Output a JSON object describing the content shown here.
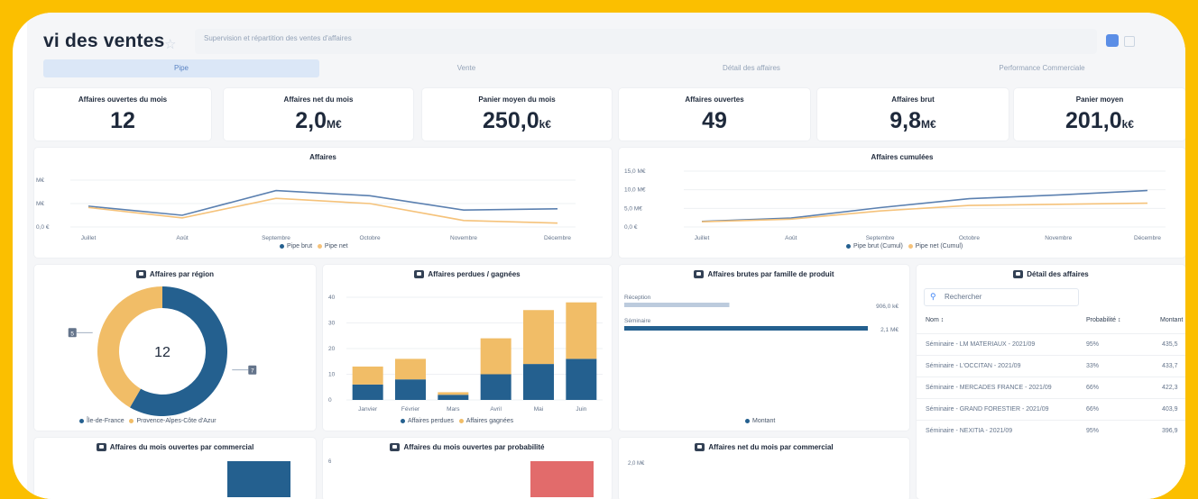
{
  "app": {
    "title": "vi des ventes",
    "subtitle": "Supervision et répartition des ventes d'affaires"
  },
  "tabs": [
    "Pipe",
    "Vente",
    "Détail des affaires",
    "Performance Commerciale"
  ],
  "kpis": [
    {
      "label": "Affaires ouvertes du mois",
      "value": "12",
      "unit": ""
    },
    {
      "label": "Affaires net du mois",
      "value": "2,0",
      "unit": "M€"
    },
    {
      "label": "Panier moyen du mois",
      "value": "250,0",
      "unit": "k€"
    },
    {
      "label": "Affaires ouvertes",
      "value": "49",
      "unit": ""
    },
    {
      "label": "Affaires brut",
      "value": "9,8",
      "unit": "M€"
    },
    {
      "label": "Panier moyen",
      "value": "201,0",
      "unit": "k€"
    }
  ],
  "colors": {
    "brut": "#5b80b0",
    "net": "#f5c27a",
    "dark_blue": "#24608f",
    "orange": "#f1bd67",
    "light": "#bccbdd",
    "red": "#e26b6b"
  },
  "chart_data": [
    {
      "type": "line",
      "title": "Affaires",
      "categories": [
        "Juillet",
        "Août",
        "Septembre",
        "Octobre",
        "Novembre",
        "Décembre"
      ],
      "y_ticks": [
        "M€",
        "M€",
        "0,0 €"
      ],
      "series": [
        {
          "name": "Pipe brut",
          "values": [
            1.6,
            0.9,
            2.8,
            2.4,
            1.3,
            1.4
          ]
        },
        {
          "name": "Pipe net",
          "values": [
            1.5,
            0.7,
            2.2,
            1.8,
            0.5,
            0.3
          ]
        }
      ],
      "ylim": [
        0,
        3.6
      ],
      "legend_position": "bottom"
    },
    {
      "type": "line",
      "title": "Affaires cumulées",
      "categories": [
        "Juillet",
        "Août",
        "Septembre",
        "Octobre",
        "Novembre",
        "Décembre"
      ],
      "y_ticks": [
        "15,0 M€",
        "10,0 M€",
        "5,0 M€",
        "0,0 €"
      ],
      "series": [
        {
          "name": "Pipe brut (Cumul)",
          "values": [
            1.5,
            2.4,
            5.2,
            7.6,
            8.6,
            9.8
          ]
        },
        {
          "name": "Pipe net (Cumul)",
          "values": [
            1.4,
            2.1,
            4.3,
            5.8,
            6.1,
            6.4
          ]
        }
      ],
      "ylim": [
        0,
        15
      ],
      "legend_position": "bottom"
    },
    {
      "type": "pie",
      "title": "Affaires par région",
      "center_label": "12",
      "slices": [
        {
          "name": "Île-de-France",
          "value": 7
        },
        {
          "name": "Provence-Alpes-Côte d'Azur",
          "value": 5
        }
      ],
      "legend_position": "bottom"
    },
    {
      "type": "bar",
      "title": "Affaires perdues / gagnées",
      "categories": [
        "Janvier",
        "Février",
        "Mars",
        "Avril",
        "Mai",
        "Juin"
      ],
      "y_ticks": [
        "40",
        "30",
        "20",
        "10",
        "0"
      ],
      "series": [
        {
          "name": "Affaires perdues",
          "values": [
            6,
            8,
            2,
            10,
            14,
            16
          ]
        },
        {
          "name": "Affaires gagnées",
          "values": [
            7,
            8,
            1,
            14,
            21,
            22
          ]
        }
      ],
      "stacked": true,
      "ylim": [
        0,
        40
      ],
      "legend_position": "bottom"
    },
    {
      "type": "bar",
      "title": "Affaires brutes par famille de produit",
      "orientation": "horizontal",
      "categories": [
        "Réception",
        "Séminaire"
      ],
      "value_labels": [
        "906,0 k€",
        "2,1 M€"
      ],
      "values": [
        0.906,
        2.1
      ],
      "series_name": "Montant",
      "legend_position": "bottom"
    }
  ],
  "detail": {
    "title": "Détail des affaires",
    "search_placeholder": "Rechercher",
    "columns": [
      "Nom",
      "Probabilité",
      "Montant"
    ],
    "rows": [
      {
        "nom": "Séminaire - LM MATERIAUX - 2021/09",
        "prob": "95%",
        "montant": "435,5"
      },
      {
        "nom": "Séminaire - L'OCCITAN - 2021/09",
        "prob": "33%",
        "montant": "433,7"
      },
      {
        "nom": "Séminaire - MERCADES FRANCE - 2021/09",
        "prob": "66%",
        "montant": "422,3"
      },
      {
        "nom": "Séminaire - GRAND FORESTIER - 2021/09",
        "prob": "66%",
        "montant": "403,9"
      },
      {
        "nom": "Séminaire - NEXITIA - 2021/09",
        "prob": "95%",
        "montant": "396,9"
      }
    ]
  },
  "bottom_cards": [
    {
      "title": "Affaires du mois ouvertes par commercial"
    },
    {
      "title": "Affaires du mois ouvertes par probabilité",
      "tick": "6"
    },
    {
      "title": "Affaires net du mois par commercial",
      "tick": "2,0 M€"
    }
  ]
}
